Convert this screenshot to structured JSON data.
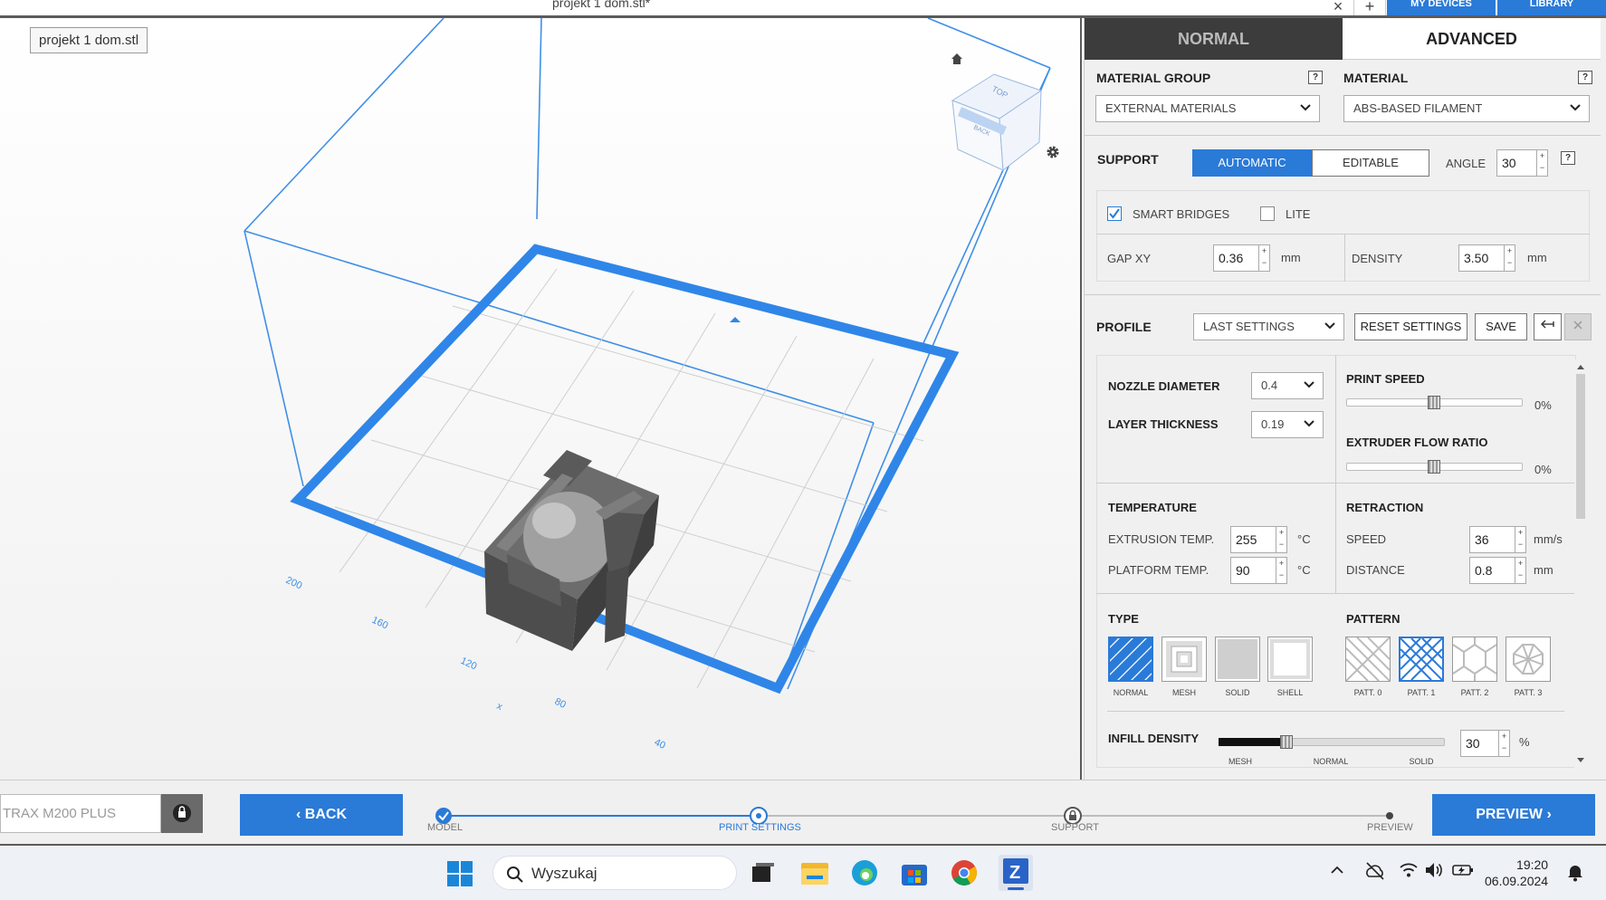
{
  "window": {
    "title": "projekt 1 dom.stl*",
    "close_tab": "×",
    "add_tab": "+",
    "nav_my_devices": "MY DEVICES",
    "nav_library": "LIBRARY"
  },
  "viewport": {
    "file_label": "projekt 1 dom.stl",
    "axis_ticks": [
      "200",
      "160",
      "120",
      "x",
      "80",
      "40"
    ],
    "cube_faces": [
      "TOP",
      "BACK"
    ]
  },
  "panel": {
    "tabs": {
      "normal": "NORMAL",
      "advanced": "ADVANCED"
    },
    "material_group": {
      "label": "MATERIAL GROUP",
      "value": "EXTERNAL MATERIALS"
    },
    "material": {
      "label": "MATERIAL",
      "value": "ABS-BASED FILAMENT"
    },
    "help": "?",
    "support": {
      "label": "SUPPORT",
      "automatic": "AUTOMATIC",
      "editable": "EDITABLE",
      "angle_label": "ANGLE",
      "angle_value": "30",
      "smart_bridges": "SMART BRIDGES",
      "smart_bridges_checked": true,
      "lite": "LITE",
      "lite_checked": false,
      "gap_xy_label": "GAP XY",
      "gap_xy_value": "0.36",
      "gap_xy_unit": "mm",
      "density_label": "DENSITY",
      "density_value": "3.50",
      "density_unit": "mm"
    },
    "profile": {
      "label": "PROFILE",
      "value": "LAST SETTINGS",
      "reset": "RESET SETTINGS",
      "save": "SAVE"
    },
    "nozzle": {
      "label": "NOZZLE DIAMETER",
      "value": "0.4"
    },
    "layer": {
      "label": "LAYER THICKNESS",
      "value": "0.19"
    },
    "print_speed": {
      "label": "PRINT SPEED",
      "value": "0%",
      "level": 0.5
    },
    "extruder_flow": {
      "label": "EXTRUDER FLOW RATIO",
      "value": "0%",
      "level": 0.5
    },
    "temperature": {
      "label": "TEMPERATURE",
      "extrusion_label": "EXTRUSION TEMP.",
      "extrusion_value": "255",
      "platform_label": "PLATFORM TEMP.",
      "platform_value": "90",
      "unit": "°C"
    },
    "retraction": {
      "label": "RETRACTION",
      "speed_label": "SPEED",
      "speed_value": "36",
      "speed_unit": "mm/s",
      "distance_label": "DISTANCE",
      "distance_value": "0.8",
      "distance_unit": "mm"
    },
    "type": {
      "label": "TYPE",
      "items": [
        "NORMAL",
        "MESH",
        "SOLID",
        "SHELL"
      ],
      "selected": "NORMAL"
    },
    "pattern": {
      "label": "PATTERN",
      "items": [
        "PATT. 0",
        "PATT. 1",
        "PATT. 2",
        "PATT. 3"
      ],
      "selected": "PATT. 1"
    },
    "infill": {
      "label": "INFILL DENSITY",
      "value": "30",
      "unit": "%",
      "level": 0.3,
      "marks": [
        "MESH",
        "NORMAL",
        "SOLID"
      ]
    }
  },
  "bottom": {
    "device": "TRAX M200 PLUS",
    "back": "BACK",
    "preview": "PREVIEW",
    "steps": [
      "MODEL",
      "PRINT SETTINGS",
      "SUPPORT",
      "PREVIEW"
    ]
  },
  "taskbar": {
    "search": "Wyszukaj",
    "time": "19:20",
    "date": "06.09.2024"
  },
  "colors": {
    "accent": "#2a7ad8",
    "dark_tab": "#3c3c3c"
  }
}
